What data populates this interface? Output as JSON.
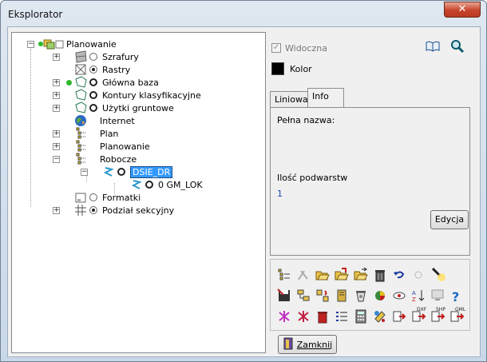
{
  "window": {
    "title": "Eksplorator",
    "close_label": "✕"
  },
  "tree": {
    "root": {
      "label": "Planowanie"
    },
    "items": [
      {
        "label": "Szrafury",
        "radio": "off"
      },
      {
        "label": "Rastry",
        "radio": "on"
      },
      {
        "label": "Główna baza",
        "radio": "bold"
      },
      {
        "label": "Kontury klasyfikacyjne",
        "radio": "bold"
      },
      {
        "label": "Użytki gruntowe",
        "radio": "bold"
      },
      {
        "label": "Internet"
      },
      {
        "label": "Plan"
      },
      {
        "label": "Planowanie"
      },
      {
        "label": "Robocze"
      },
      {
        "label": "DSIE_DR",
        "radio": "bold",
        "selected": true
      },
      {
        "label": "0 GM_LOK",
        "radio": "bold"
      },
      {
        "label": "Formatki",
        "radio": "off"
      },
      {
        "label": "Podział sekcyjny",
        "radio": "on"
      }
    ]
  },
  "properties": {
    "visible_label": "Widoczna",
    "visible_checked": true,
    "color_label": "Kolor",
    "color_value": "#000000",
    "tabs": [
      {
        "label": "Liniowa"
      },
      {
        "label": "Info"
      }
    ],
    "active_tab": "Info",
    "info": {
      "full_name_label": "Pełna nazwa:",
      "full_name_value": "",
      "sublayers_label": "Ilość podwarstw",
      "sublayers_value": "1"
    },
    "edit_button": "Edycja"
  },
  "toolbar": {
    "icons": [
      "layer-list-icon",
      "delete-layer-icon",
      "open-folder-icon",
      "open-folder-red-icon",
      "open-folder-arrow-icon",
      "trash-icon",
      "undo-icon",
      "circle-icon",
      "highlight-icon",
      "save-icon",
      "folder-tree-icon",
      "refresh-icon",
      "book-icon",
      "recycle-bin-icon",
      "pie-chart-icon",
      "eye-icon",
      "sort-icon",
      "monitor-icon",
      "help-icon",
      "pink-plus-icon",
      "red-plus-icon",
      "red-trash-icon",
      "list-icon",
      "calculator-icon",
      "paint-icon",
      "export-icon",
      "dxf-export-icon",
      "shp-export-icon",
      "gml-export-icon"
    ]
  },
  "footer": {
    "close_button": "Zamknij"
  }
}
